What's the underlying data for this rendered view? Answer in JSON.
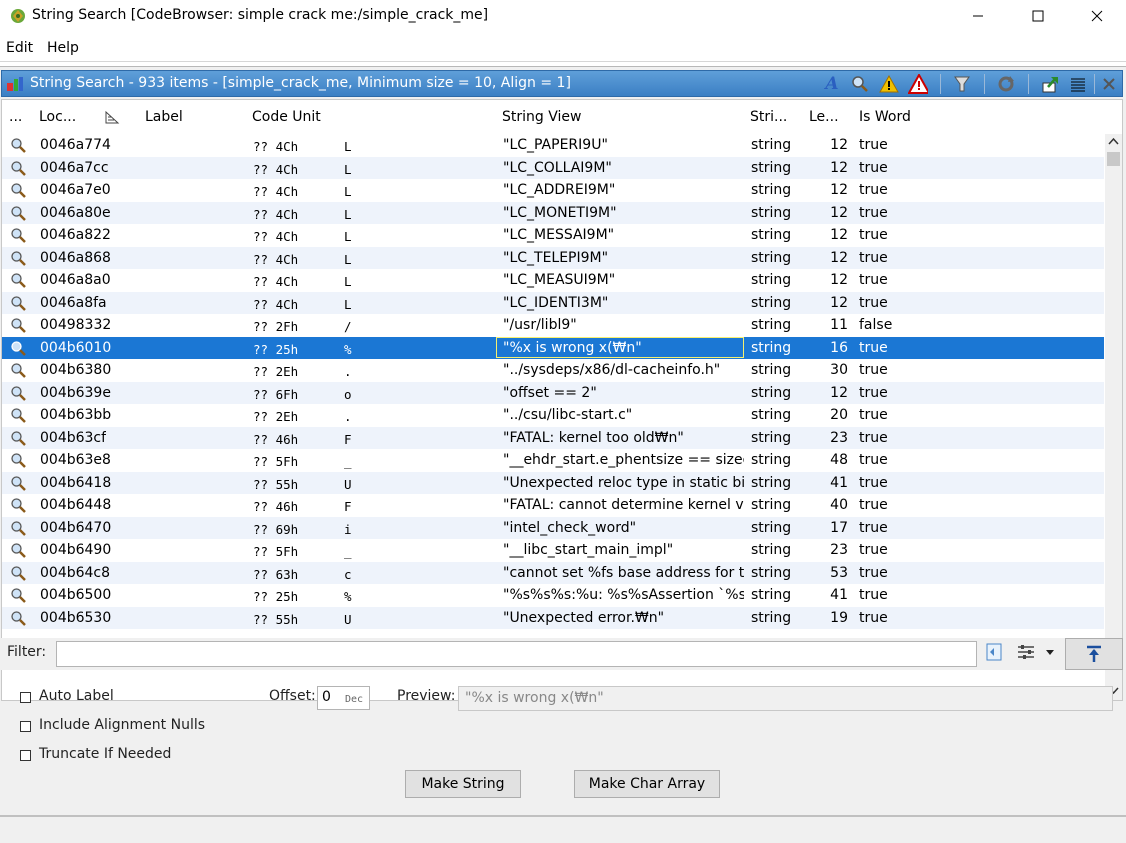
{
  "window": {
    "title": "String Search [CodeBrowser: simple crack me:/simple_crack_me]"
  },
  "menu": [
    "Edit",
    "Help"
  ],
  "panel": {
    "title": "String Search - 933 items - [simple_crack_me, Minimum size = 10, Align = 1]",
    "toolbar_icons": [
      "font-icon",
      "search-icon",
      "warning-icon",
      "warning-outline-icon",
      "filter-icon",
      "refresh-icon",
      "export-icon",
      "menu-icon",
      "close-icon"
    ]
  },
  "table": {
    "columns": [
      "...",
      "Loc...",
      "Label",
      "Code Unit",
      "String View",
      "Stri...",
      "Le...",
      "Is Word"
    ],
    "rows": [
      {
        "loc": "0046a774",
        "code": "?? 4Ch",
        "ch": "L",
        "view": "\"LC_PAPERI9U\"",
        "type": "string",
        "len": "12",
        "word": "true"
      },
      {
        "loc": "0046a7cc",
        "code": "?? 4Ch",
        "ch": "L",
        "view": "\"LC_COLLAI9M\"",
        "type": "string",
        "len": "12",
        "word": "true"
      },
      {
        "loc": "0046a7e0",
        "code": "?? 4Ch",
        "ch": "L",
        "view": "\"LC_ADDREI9M\"",
        "type": "string",
        "len": "12",
        "word": "true"
      },
      {
        "loc": "0046a80e",
        "code": "?? 4Ch",
        "ch": "L",
        "view": "\"LC_MONETI9M\"",
        "type": "string",
        "len": "12",
        "word": "true"
      },
      {
        "loc": "0046a822",
        "code": "?? 4Ch",
        "ch": "L",
        "view": "\"LC_MESSAI9M\"",
        "type": "string",
        "len": "12",
        "word": "true"
      },
      {
        "loc": "0046a868",
        "code": "?? 4Ch",
        "ch": "L",
        "view": "\"LC_TELEPI9M\"",
        "type": "string",
        "len": "12",
        "word": "true"
      },
      {
        "loc": "0046a8a0",
        "code": "?? 4Ch",
        "ch": "L",
        "view": "\"LC_MEASUI9M\"",
        "type": "string",
        "len": "12",
        "word": "true"
      },
      {
        "loc": "0046a8fa",
        "code": "?? 4Ch",
        "ch": "L",
        "view": "\"LC_IDENTI3M\"",
        "type": "string",
        "len": "12",
        "word": "true"
      },
      {
        "loc": "00498332",
        "code": "?? 2Fh",
        "ch": "/",
        "view": "\"/usr/libl9\"",
        "type": "string",
        "len": "11",
        "word": "false"
      },
      {
        "loc": "004b6010",
        "code": "?? 25h",
        "ch": "%",
        "view": "\"%x is wrong x(₩n\"",
        "type": "string",
        "len": "16",
        "word": "true"
      },
      {
        "loc": "004b6380",
        "code": "?? 2Eh",
        "ch": ".",
        "view": "\"../sysdeps/x86/dl-cacheinfo.h\"",
        "type": "string",
        "len": "30",
        "word": "true"
      },
      {
        "loc": "004b639e",
        "code": "?? 6Fh",
        "ch": "o",
        "view": "\"offset == 2\"",
        "type": "string",
        "len": "12",
        "word": "true"
      },
      {
        "loc": "004b63bb",
        "code": "?? 2Eh",
        "ch": ".",
        "view": "\"../csu/libc-start.c\"",
        "type": "string",
        "len": "20",
        "word": "true"
      },
      {
        "loc": "004b63cf",
        "code": "?? 46h",
        "ch": "F",
        "view": "\"FATAL: kernel too old₩n\"",
        "type": "string",
        "len": "23",
        "word": "true"
      },
      {
        "loc": "004b63e8",
        "code": "?? 5Fh",
        "ch": "_",
        "view": "\"__ehdr_start.e_phentsize == sizeof...",
        "type": "string",
        "len": "48",
        "word": "true"
      },
      {
        "loc": "004b6418",
        "code": "?? 55h",
        "ch": "U",
        "view": "\"Unexpected reloc type in static bin...",
        "type": "string",
        "len": "41",
        "word": "true"
      },
      {
        "loc": "004b6448",
        "code": "?? 46h",
        "ch": "F",
        "view": "\"FATAL: cannot determine kernel v...",
        "type": "string",
        "len": "40",
        "word": "true"
      },
      {
        "loc": "004b6470",
        "code": "?? 69h",
        "ch": "i",
        "view": "\"intel_check_word\"",
        "type": "string",
        "len": "17",
        "word": "true"
      },
      {
        "loc": "004b6490",
        "code": "?? 5Fh",
        "ch": "_",
        "view": "\"__libc_start_main_impl\"",
        "type": "string",
        "len": "23",
        "word": "true"
      },
      {
        "loc": "004b64c8",
        "code": "?? 63h",
        "ch": "c",
        "view": "\"cannot set %fs base address for t...",
        "type": "string",
        "len": "53",
        "word": "true"
      },
      {
        "loc": "004b6500",
        "code": "?? 25h",
        "ch": "%",
        "view": "\"%s%s%s:%u: %s%sAssertion `%s...",
        "type": "string",
        "len": "41",
        "word": "true"
      },
      {
        "loc": "004b6530",
        "code": "?? 55h",
        "ch": "U",
        "view": "\"Unexpected error.₩n\"",
        "type": "string",
        "len": "19",
        "word": "true"
      }
    ],
    "selected_index": 9
  },
  "filter": {
    "label": "Filter:",
    "value": ""
  },
  "options": {
    "auto_label": "Auto Label",
    "include_alignment_nulls": "Include Alignment Nulls",
    "truncate_if_needed": "Truncate If Needed",
    "offset_label": "Offset:",
    "offset_value": "0",
    "offset_unit": "Dec",
    "preview_label": "Preview:",
    "preview_value": "\"%x is wrong x(₩n\""
  },
  "buttons": {
    "make_string": "Make String",
    "make_char_array": "Make Char Array"
  },
  "colors": {
    "selection": "#1b77d4",
    "header_blue": "#3b7fc4",
    "alt_row": "#eef3fb"
  }
}
